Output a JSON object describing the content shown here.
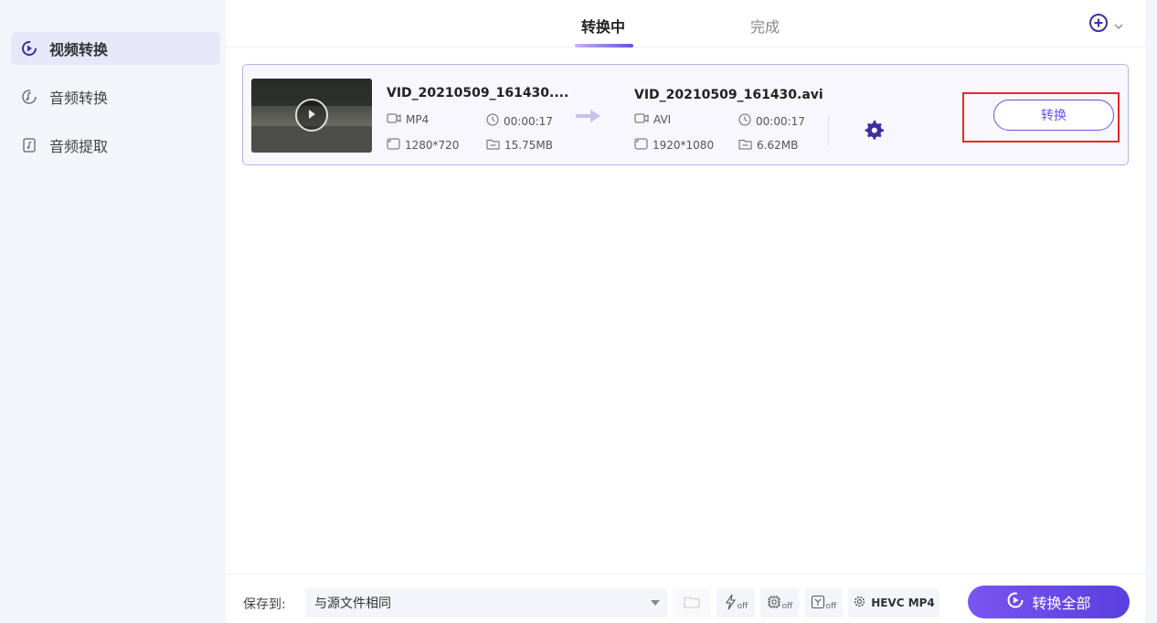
{
  "sidebar": {
    "items": [
      {
        "label": "视频转换",
        "icon": "video-convert-icon",
        "active": true
      },
      {
        "label": "音频转换",
        "icon": "audio-convert-icon",
        "active": false
      },
      {
        "label": "音频提取",
        "icon": "audio-extract-icon",
        "active": false
      }
    ]
  },
  "tabs": [
    {
      "label": "转换中",
      "active": true
    },
    {
      "label": "完成",
      "active": false
    }
  ],
  "header": {
    "add_icon": "plus-circle-icon",
    "dropdown_icon": "chevron-down-icon"
  },
  "file": {
    "source": {
      "name": "VID_20210509_161430....",
      "format": "MP4",
      "duration": "00:00:17",
      "resolution": "1280*720",
      "size": "15.75MB"
    },
    "target": {
      "name": "VID_20210509_161430.avi",
      "format": "AVI",
      "duration": "00:00:17",
      "resolution": "1920*1080",
      "size": "6.62MB"
    },
    "convert_label": "转换"
  },
  "bottom": {
    "save_to_label": "保存到:",
    "save_to_value": "与源文件相同",
    "off_label": "off",
    "hevc_label": "HEVC MP4",
    "convert_all_label": "转换全部"
  },
  "colors": {
    "accent": "#6b4fe0",
    "highlight": "#e02a2a",
    "sidebar_active": "#e6e7f8"
  }
}
